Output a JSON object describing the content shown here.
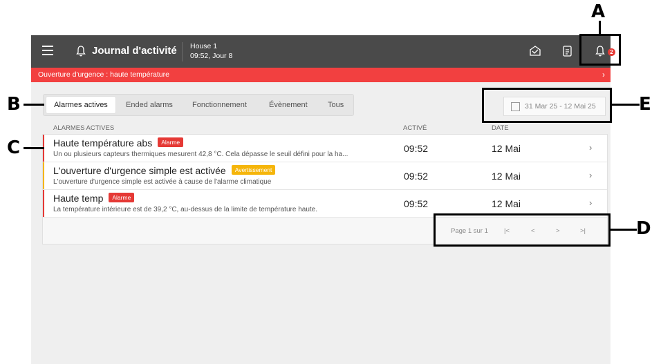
{
  "header": {
    "title": "Journal d'activité",
    "house_name": "House 1",
    "house_time": "09:52, Jour 8",
    "notification_count": "2"
  },
  "alarm_banner": {
    "text": "Ouverture d'urgence : haute température",
    "chevron": "›"
  },
  "tabs": [
    {
      "label": "Alarmes actives",
      "active": true
    },
    {
      "label": "Ended alarms",
      "active": false
    },
    {
      "label": "Fonctionnement",
      "active": false
    },
    {
      "label": "Évènement",
      "active": false
    },
    {
      "label": "Tous",
      "active": false
    }
  ],
  "date_range": "31 Mar 25 - 12 Mai 25",
  "table": {
    "headers": {
      "name": "ALARMES ACTIVES",
      "active": "ACTIVÉ",
      "date": "DATE"
    },
    "rows": [
      {
        "title": "Haute température abs",
        "badge": "Alarme",
        "badge_color": "#e53935",
        "stripe_color": "#e53935",
        "desc": "Un ou plusieurs capteurs thermiques mesurent 42,8 °C. Cela dépasse le seuil défini pour la ha...",
        "time": "09:52",
        "date": "12 Mai",
        "chevron": "›"
      },
      {
        "title": "L'ouverture d'urgence simple est activée",
        "badge": "Avertissement",
        "badge_color": "#f5b50a",
        "stripe_color": "#f5b50a",
        "desc": "L'ouverture d'urgence simple est activée à cause de l'alarme climatique",
        "time": "09:52",
        "date": "12 Mai",
        "chevron": "›"
      },
      {
        "title": "Haute temp",
        "badge": "Alarme",
        "badge_color": "#e53935",
        "stripe_color": "#e53935",
        "desc": "La température intérieure est de 39,2 °C, au-dessus de la limite de température haute.",
        "time": "09:52",
        "date": "12 Mai",
        "chevron": "›"
      }
    ]
  },
  "pagination": {
    "label": "Page 1 sur 1",
    "first": "|<",
    "prev": "<",
    "next": ">",
    "last": ">|"
  },
  "callouts": {
    "a": "A",
    "b": "B",
    "c": "C",
    "d": "D",
    "e": "E"
  },
  "colors": {
    "topbar": "#4a4a4a",
    "alarm_banner": "#f24040",
    "background": "#efefef"
  }
}
